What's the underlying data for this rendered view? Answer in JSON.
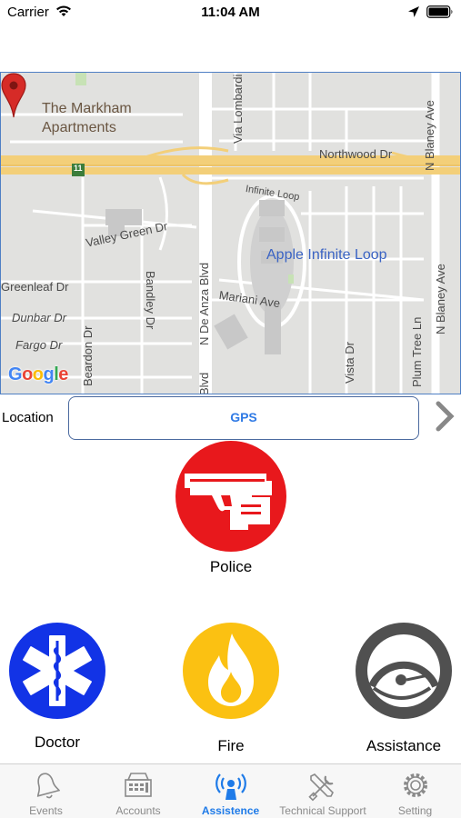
{
  "status_bar": {
    "carrier": "Carrier",
    "time": "11:04 AM",
    "icons": [
      "wifi-icon",
      "location-arrow-icon",
      "battery-icon"
    ]
  },
  "map": {
    "place_labels": {
      "markham": "The Markham\nApartments",
      "apple": "Apple Infinite Loop"
    },
    "streets": {
      "northwood": "Northwood Dr",
      "via_lombardi": "Via Lombardi",
      "infinite_loop": "Infinite Loop",
      "valley_green": "Valley Green Dr",
      "bandley": "Bandley Dr",
      "n_de_anza": "N De Anza Blvd",
      "n_de_anza_bottom": "Blvd",
      "mariani": "Mariani Ave",
      "greenleaf": "Greenleaf Dr",
      "dunbar": "Dunbar Dr",
      "fargo": "Fargo Dr",
      "beardon": "Beardon Dr",
      "vista": "Vista Dr",
      "plum_tree": "Plum Tree Ln",
      "n_blaney_top": "N Blaney Ave",
      "n_blaney_mid": "N Blaney Ave"
    },
    "highway_shield": "11",
    "logo": "Google",
    "colors": {
      "road": "#ffffff",
      "highway": "#f3cf79",
      "land": "#e1e1df",
      "poi": "#3a63c4",
      "pin": "#d62b27"
    }
  },
  "location": {
    "label": "Location",
    "value": "GPS",
    "accent": "#2f7ae5"
  },
  "actions": {
    "police": {
      "label": "Police",
      "color": "#e8181c",
      "icon": "gun-icon"
    },
    "doctor": {
      "label": "Doctor",
      "color": "#1233e6",
      "icon": "star-of-life-icon"
    },
    "fire": {
      "label": "Fire",
      "color": "#fbc112",
      "icon": "flame-icon"
    },
    "assistance": {
      "label": "Assistance",
      "color": "#505050",
      "icon": "headset-icon"
    }
  },
  "tab_bar": {
    "active_color": "#1f7be8",
    "tabs": [
      {
        "label": "Events",
        "icon": "bell-icon"
      },
      {
        "label": "Accounts",
        "icon": "register-icon"
      },
      {
        "label": "Assistence",
        "icon": "signal-person-icon"
      },
      {
        "label": "Technical Support",
        "icon": "tools-icon"
      },
      {
        "label": "Setting",
        "icon": "gear-icon"
      }
    ]
  }
}
